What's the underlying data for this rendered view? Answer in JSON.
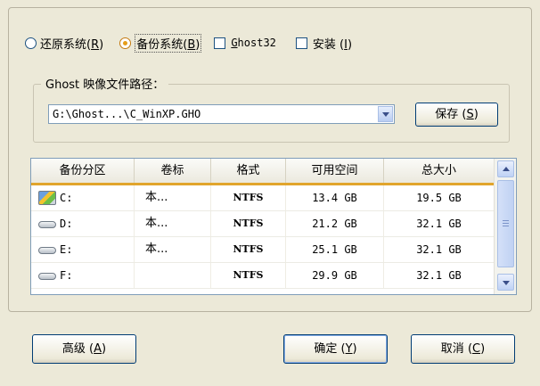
{
  "mode_options": {
    "restore": {
      "label": "还原系统",
      "key": "R",
      "selected": false
    },
    "backup": {
      "label": "备份系统",
      "key": "B",
      "selected": true
    },
    "ghost32": {
      "key": "G",
      "rest": "host32",
      "checked": false
    },
    "install": {
      "label": "安装",
      "key": "I",
      "checked": false
    }
  },
  "path_group": {
    "title": "Ghost 映像文件路径：",
    "value": "G:\\Ghost...\\C_WinXP.GHO",
    "save_label": "保存",
    "save_key": "S"
  },
  "table": {
    "columns": [
      "备份分区",
      "卷标",
      "格式",
      "可用空间",
      "总大小"
    ],
    "rows": [
      {
        "drive": "C:",
        "label": "本...",
        "format": "NTFS",
        "free": "13.4 GB",
        "total": "19.5 GB",
        "icon": "system-drive-icon"
      },
      {
        "drive": "D:",
        "label": "本...",
        "format": "NTFS",
        "free": "21.2 GB",
        "total": "32.1 GB",
        "icon": "hard-drive-icon"
      },
      {
        "drive": "E:",
        "label": "本...",
        "format": "NTFS",
        "free": "25.1 GB",
        "total": "32.1 GB",
        "icon": "hard-drive-icon"
      },
      {
        "drive": "F:",
        "label": "",
        "format": "NTFS",
        "free": "29.9 GB",
        "total": "32.1 GB",
        "icon": "hard-drive-icon"
      }
    ]
  },
  "buttons": {
    "advanced": {
      "label": "高级",
      "key": "A"
    },
    "ok": {
      "label": "确定",
      "key": "Y"
    },
    "cancel": {
      "label": "取消",
      "key": "C"
    }
  },
  "colors": {
    "window_bg": "#ece9d8",
    "header_accent": "#e1a52c",
    "radio_selected": "#e59d1a"
  }
}
